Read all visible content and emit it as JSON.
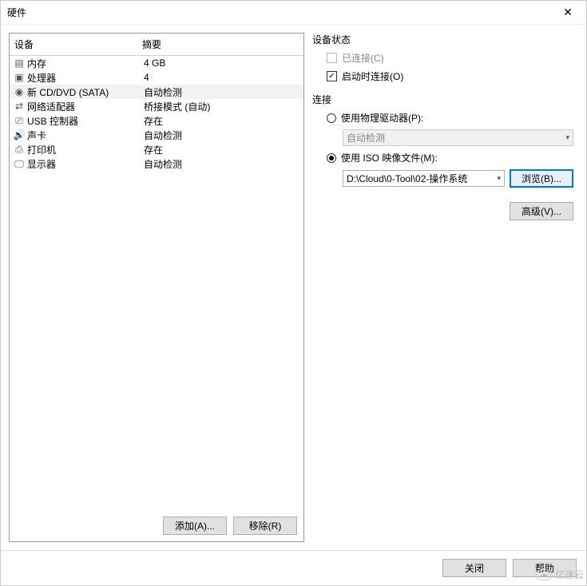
{
  "window": {
    "title": "硬件",
    "close_x": "✕"
  },
  "hw_table": {
    "header_device": "设备",
    "header_summary": "摘要",
    "rows": [
      {
        "icon": "memory",
        "name": "内存",
        "summary": "4 GB",
        "selected": false
      },
      {
        "icon": "cpu",
        "name": "处理器",
        "summary": "4",
        "selected": false
      },
      {
        "icon": "cd",
        "name": "新 CD/DVD (SATA)",
        "summary": "自动检测",
        "selected": true
      },
      {
        "icon": "network",
        "name": "网络适配器",
        "summary": "桥接模式 (自动)",
        "selected": false
      },
      {
        "icon": "usb",
        "name": "USB 控制器",
        "summary": "存在",
        "selected": false
      },
      {
        "icon": "sound",
        "name": "声卡",
        "summary": "自动检测",
        "selected": false
      },
      {
        "icon": "printer",
        "name": "打印机",
        "summary": "存在",
        "selected": false
      },
      {
        "icon": "display",
        "name": "显示器",
        "summary": "自动检测",
        "selected": false
      }
    ]
  },
  "left_buttons": {
    "add": "添加(A)...",
    "remove": "移除(R)"
  },
  "status_group": {
    "title": "设备状态",
    "connected_label": "已连接(C)",
    "connected_checked": false,
    "connected_enabled": false,
    "connect_on_start_label": "启动时连接(O)",
    "connect_on_start_checked": true
  },
  "connection_group": {
    "title": "连接",
    "physical_label": "使用物理驱动器(P):",
    "physical_selected": false,
    "physical_dropdown": "自动检测",
    "iso_label": "使用 ISO 映像文件(M):",
    "iso_selected": true,
    "iso_path": "D:\\Cloud\\0-Tool\\02-操作系统",
    "browse_button": "浏览(B)..."
  },
  "advanced_button": "高级(V)...",
  "footer": {
    "close": "关闭",
    "help": "帮助"
  },
  "watermark": "亿速云"
}
